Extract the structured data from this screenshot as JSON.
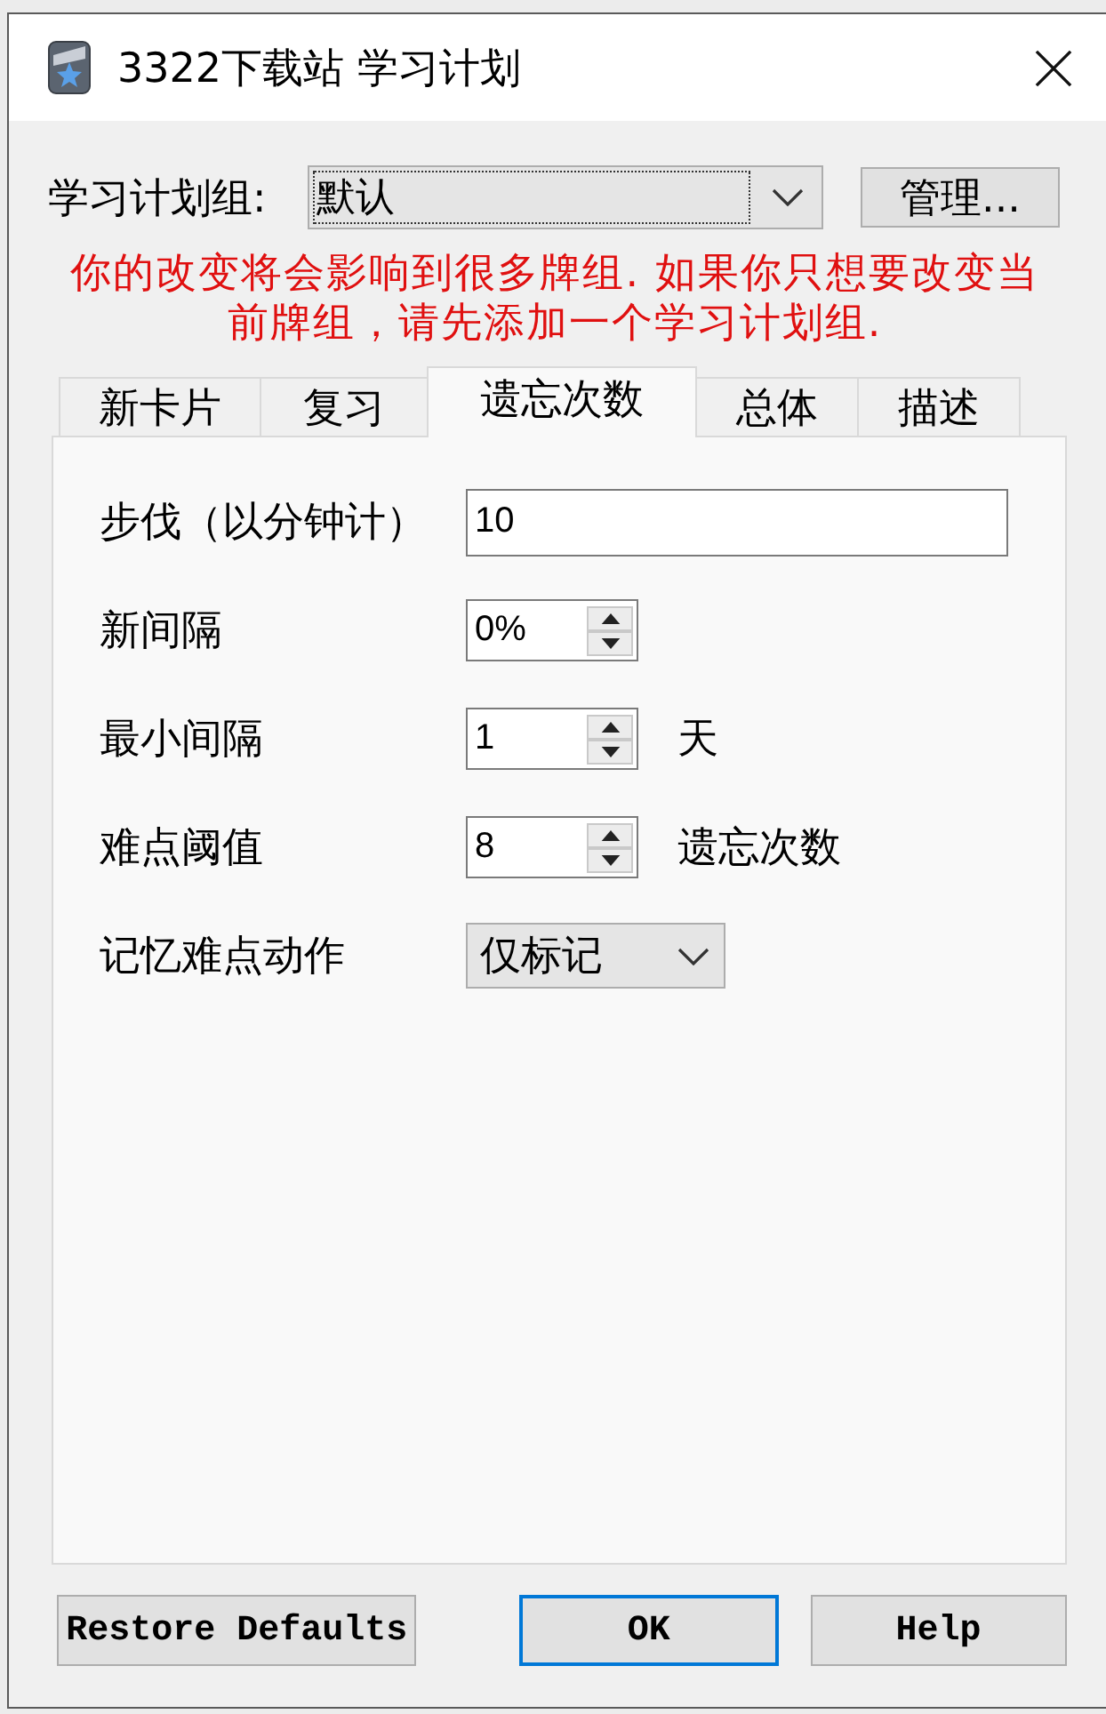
{
  "window": {
    "title": "3322下载站 学习计划"
  },
  "plan_group": {
    "label": "学习计划组:",
    "value": "默认",
    "focused": true,
    "manage_button": "管理..."
  },
  "warning": "你的改变将会影响到很多牌组. 如果你只想要改变当前牌组，请先添加一个学习计划组.",
  "tabs": [
    {
      "label": "新卡片",
      "selected": false
    },
    {
      "label": "复习",
      "selected": false
    },
    {
      "label": "遗忘次数",
      "selected": true
    },
    {
      "label": "总体",
      "selected": false
    },
    {
      "label": "描述",
      "selected": false
    }
  ],
  "fields": [
    {
      "kind": "text",
      "label": "步伐（以分钟计）",
      "value": "10"
    },
    {
      "kind": "spin",
      "label": "新间隔",
      "value": "0%"
    },
    {
      "kind": "spin",
      "label": "最小间隔",
      "value": "1",
      "unit": "天"
    },
    {
      "kind": "spin",
      "label": "难点阈值",
      "value": "8",
      "unit": "遗忘次数"
    },
    {
      "kind": "select",
      "label": "记忆难点动作",
      "value": "仅标记"
    }
  ],
  "buttons": [
    {
      "label": "Restore Defaults",
      "default": false
    },
    {
      "label": "OK",
      "default": true
    },
    {
      "label": "Help",
      "default": false
    }
  ]
}
